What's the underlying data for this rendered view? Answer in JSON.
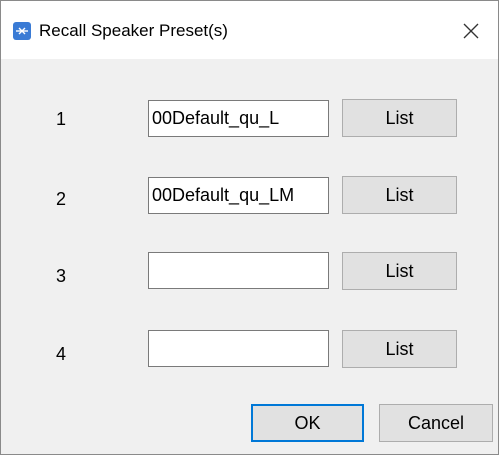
{
  "window": {
    "title": "Recall Speaker Preset(s)",
    "app_icon": "speaker-preset-app-icon",
    "close_icon": "close-icon",
    "accent_color": "#0078d7",
    "icon_color": "#3a7bd5"
  },
  "presets": [
    {
      "index": "1",
      "value": "00Default_qu_L",
      "list_label": "List"
    },
    {
      "index": "2",
      "value": "00Default_qu_LM",
      "list_label": "List"
    },
    {
      "index": "3",
      "value": "",
      "list_label": "List"
    },
    {
      "index": "4",
      "value": "",
      "list_label": "List"
    }
  ],
  "footer": {
    "ok_label": "OK",
    "cancel_label": "Cancel"
  }
}
